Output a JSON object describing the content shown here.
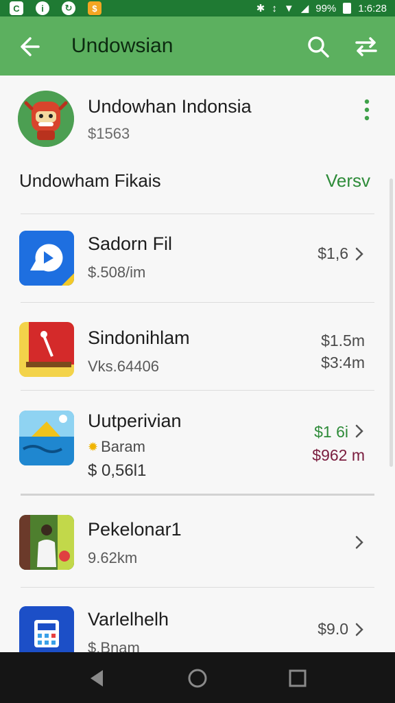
{
  "status_bar": {
    "battery": "99%",
    "time": "1:6:28",
    "icons": [
      "notification-icon",
      "info-icon",
      "refresh-icon",
      "app-notification-icon",
      "bluetooth-icon",
      "vibrate-icon",
      "wifi-icon",
      "signal-icon",
      "battery-icon"
    ]
  },
  "app_bar": {
    "title": "Undowsian",
    "back_icon": "arrow-left-icon",
    "search_icon": "search-icon",
    "swap_icon": "swap-icon"
  },
  "header": {
    "name": "Undowhan Indonsia",
    "amount": "$1563",
    "menu_icon": "more-vert-icon"
  },
  "section": {
    "title": "Undowham Fikais",
    "action": "Versv"
  },
  "rows": [
    {
      "title": "Sadorn Fil",
      "subtitle": "$.508/im",
      "price": "$1,6",
      "icon": "chat-bubble-icon",
      "icon_color": "#1e6fe0"
    },
    {
      "title": "Sindonihlam",
      "subtitle": "Vks.64406",
      "price": "$1.5m",
      "price2": "$3:4m",
      "icon": "red-card-icon",
      "icon_color": "#d42a2a"
    },
    {
      "title": "Uutperivian",
      "badge": "Baram",
      "subtitle": "$ 0,56l1",
      "price": "$1 6i",
      "price2": "$962 m",
      "price_color": "#2e8b39",
      "price2_color": "#7a1d3e",
      "icon": "sea-landscape-icon",
      "icon_color": "#2f9be0"
    },
    {
      "title": "Pekelonar1",
      "subtitle": "9.62km",
      "icon": "person-photo-icon",
      "icon_color": "#2f6a2a"
    },
    {
      "title": "Varlelhelh",
      "subtitle": "$.Bnam",
      "price": "$9.0",
      "icon": "calculator-icon",
      "icon_color": "#1c4fc7"
    }
  ],
  "nav_bar": {
    "back_icon": "nav-back-icon",
    "home_icon": "nav-home-icon",
    "recents_icon": "nav-recents-icon"
  }
}
